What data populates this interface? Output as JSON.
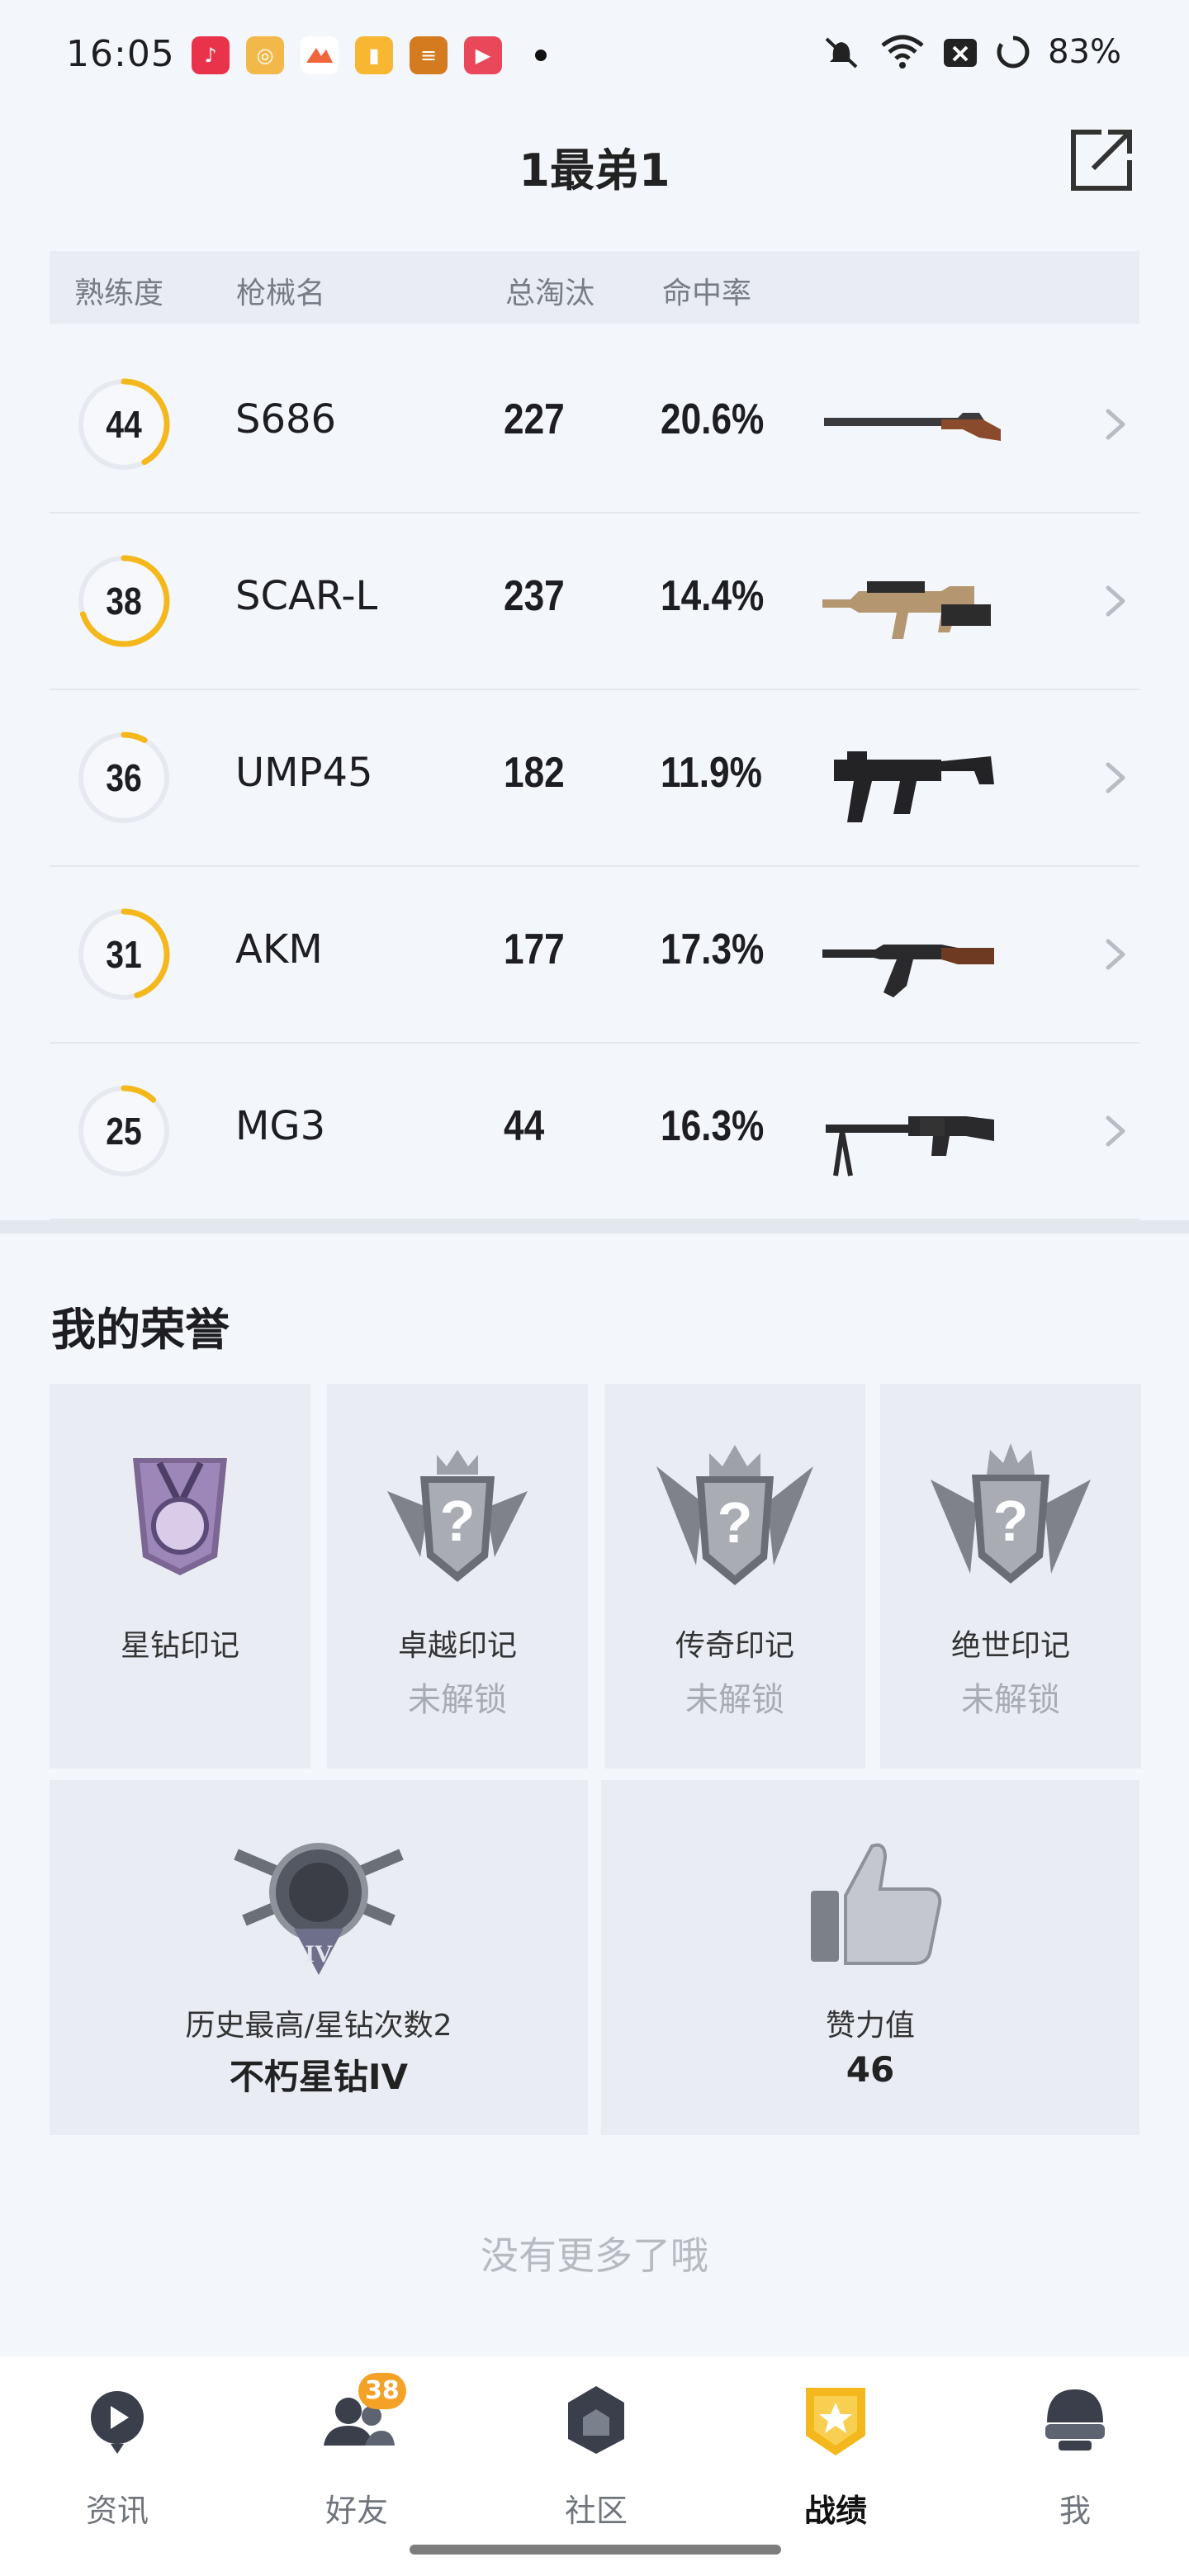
{
  "status_bar": {
    "time": "16:05",
    "battery": "83%",
    "icons": [
      "music-app-icon",
      "target-app-icon",
      "game-app-icon",
      "book-app-icon",
      "news-app-icon",
      "video-app-icon",
      "mute-icon",
      "wifi-icon",
      "sim-icon",
      "battery-icon"
    ]
  },
  "header": {
    "title": "1最弟1",
    "share_icon": "share-external-icon"
  },
  "table": {
    "columns": [
      "熟练度",
      "枪械名",
      "总淘汰",
      "命中率"
    ],
    "rows": [
      {
        "level": "44",
        "progress": 0.42,
        "name": "S686",
        "kills": "227",
        "hit_rate": "20.6%",
        "gun_icon": "shotgun-icon"
      },
      {
        "level": "38",
        "progress": 0.7,
        "name": "SCAR-L",
        "kills": "237",
        "hit_rate": "14.4%",
        "gun_icon": "assault-rifle-icon"
      },
      {
        "level": "36",
        "progress": 0.08,
        "name": "UMP45",
        "kills": "182",
        "hit_rate": "11.9%",
        "gun_icon": "smg-icon"
      },
      {
        "level": "31",
        "progress": 0.45,
        "name": "AKM",
        "kills": "177",
        "hit_rate": "17.3%",
        "gun_icon": "rifle-icon"
      },
      {
        "level": "25",
        "progress": 0.12,
        "name": "MG3",
        "kills": "44",
        "hit_rate": "16.3%",
        "gun_icon": "machine-gun-icon"
      }
    ]
  },
  "honors": {
    "title": "我的荣誉",
    "badges": [
      {
        "name": "星钻印记",
        "status": ""
      },
      {
        "name": "卓越印记",
        "status": "未解锁"
      },
      {
        "name": "传奇印记",
        "status": "未解锁"
      },
      {
        "name": "绝世印记",
        "status": "未解锁"
      }
    ],
    "rank": {
      "label": "历史最高/星钻次数2",
      "value": "不朽星钻IV",
      "emblem_text": "IV"
    },
    "likes": {
      "label": "赞力值",
      "value": "46"
    }
  },
  "footer_note": "没有更多了哦",
  "nav": {
    "items": [
      {
        "label": "资讯",
        "icon": "news-icon",
        "active": false
      },
      {
        "label": "好友",
        "icon": "friends-icon",
        "active": false,
        "badge": "38"
      },
      {
        "label": "社区",
        "icon": "community-icon",
        "active": false
      },
      {
        "label": "战绩",
        "icon": "record-icon",
        "active": true
      },
      {
        "label": "我",
        "icon": "profile-icon",
        "active": false
      }
    ]
  },
  "colors": {
    "accent": "#f5b81c",
    "ring_track": "#e6eaf0",
    "badge_orange": "#f4a227"
  }
}
